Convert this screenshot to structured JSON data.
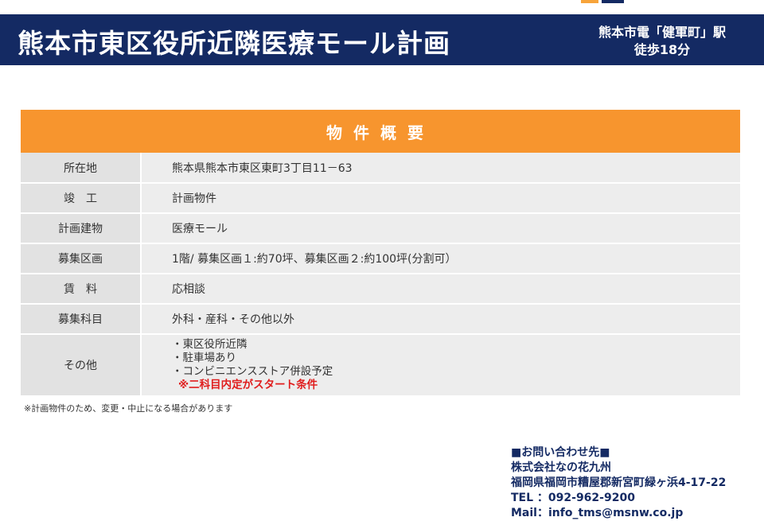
{
  "header": {
    "title": "熊本市東区役所近隣医療モール計画",
    "access_line1": "熊本市電「健軍町」駅",
    "access_line2": "徒歩18分"
  },
  "overview": {
    "heading": "物件概要",
    "rows": [
      {
        "label": "所在地",
        "value": "熊本県熊本市東区東町3丁目11－63"
      },
      {
        "label": "竣　工",
        "value": "計画物件"
      },
      {
        "label": "計画建物",
        "value": "医療モール"
      },
      {
        "label": "募集区画",
        "value": "1階/ 募集区画１:約70坪、募集区画２:約100坪(分割可）"
      },
      {
        "label": "賃　料",
        "value": "応相談"
      },
      {
        "label": "募集科目",
        "value": "外科・産科・その他以外"
      }
    ],
    "other": {
      "label": "その他",
      "items": [
        "・東区役所近隣",
        "・駐車場あり",
        "・コンビニエンスストア併設予定"
      ],
      "condition": "※二科目内定がスタート条件"
    }
  },
  "footnote": "※計画物件のため、変更・中止になる場合があります",
  "contact": {
    "heading": "■お問い合わせ先■",
    "company": "株式会社なの花九州",
    "address": "福岡県福岡市糟屋郡新宮町緑ヶ浜4-17-22",
    "tel": "TEL ：092-962-9200",
    "mail": "Mail：info_tms@msnw.co.jp"
  },
  "colors": {
    "navy": "#142a63",
    "orange": "#f7952e",
    "alert_red": "#e01e1e"
  }
}
